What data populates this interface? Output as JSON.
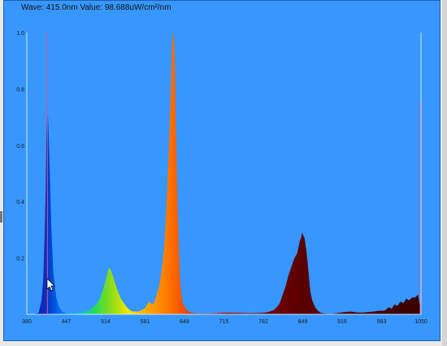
{
  "readout": {
    "label": "Wave: 415.0nm Value: 98.688uW/cm²/nm"
  },
  "colors": {
    "background": "#3797ff",
    "axis": "#c8e6ff",
    "cursor": "#cc5a8a"
  },
  "chart_data": {
    "type": "area",
    "title": "",
    "xlabel": "",
    "ylabel": "",
    "xlim": [
      380,
      1050
    ],
    "ylim": [
      0,
      1.0
    ],
    "grid": false,
    "x_ticks": [
      "380",
      "447",
      "514",
      "581",
      "648",
      "715",
      "782",
      "849",
      "916",
      "983",
      "1050"
    ],
    "y_ticks": [
      "1.0",
      "0.8",
      "0.6",
      "0.4",
      "0.2"
    ],
    "cursor_wavelength": 415.0,
    "series": [
      {
        "x": [
          380,
          390,
          400,
          405,
          408,
          410,
          412,
          413,
          414,
          415,
          416,
          417,
          418,
          420,
          422,
          425,
          430,
          435,
          440,
          445,
          450,
          455,
          460,
          470,
          480,
          490,
          500,
          505,
          510,
          515,
          518,
          520,
          522,
          525,
          530,
          535,
          540,
          545,
          550,
          555,
          560,
          570,
          580,
          585,
          588,
          590,
          593,
          596,
          600,
          605,
          610,
          613,
          616,
          619,
          622,
          625,
          626,
          627,
          628,
          629,
          630,
          631,
          632,
          633,
          634,
          636,
          638,
          640,
          642,
          645,
          650,
          655,
          660,
          670,
          680,
          690,
          700,
          710,
          720,
          740,
          760,
          780,
          790,
          800,
          805,
          810,
          815,
          820,
          825,
          830,
          835,
          838,
          840,
          842,
          844,
          846,
          848,
          850,
          852,
          855,
          858,
          860,
          862,
          865,
          870,
          875,
          880,
          890,
          900,
          910,
          920,
          930,
          940,
          950,
          960,
          970,
          980,
          985,
          990,
          995,
          1000,
          1005,
          1010,
          1015,
          1020,
          1025,
          1030,
          1035,
          1040,
          1045,
          1050
        ],
        "y": [
          0,
          0,
          0.005,
          0.05,
          0.13,
          0.26,
          0.44,
          0.58,
          0.68,
          0.72,
          0.7,
          0.64,
          0.58,
          0.43,
          0.29,
          0.15,
          0.06,
          0.025,
          0.01,
          0.005,
          0.003,
          0.003,
          0.004,
          0.006,
          0.01,
          0.02,
          0.04,
          0.06,
          0.09,
          0.13,
          0.155,
          0.165,
          0.16,
          0.145,
          0.11,
          0.08,
          0.055,
          0.04,
          0.025,
          0.015,
          0.01,
          0.01,
          0.02,
          0.035,
          0.045,
          0.04,
          0.035,
          0.04,
          0.065,
          0.1,
          0.17,
          0.23,
          0.33,
          0.46,
          0.62,
          0.82,
          0.9,
          0.95,
          0.99,
          1.0,
          0.98,
          0.93,
          0.84,
          0.72,
          0.6,
          0.4,
          0.25,
          0.14,
          0.08,
          0.04,
          0.02,
          0.01,
          0.005,
          0.003,
          0.003,
          0.003,
          0.004,
          0.005,
          0.006,
          0.005,
          0.004,
          0.005,
          0.008,
          0.015,
          0.025,
          0.04,
          0.07,
          0.1,
          0.14,
          0.17,
          0.2,
          0.21,
          0.22,
          0.24,
          0.26,
          0.27,
          0.29,
          0.28,
          0.27,
          0.23,
          0.17,
          0.12,
          0.08,
          0.05,
          0.025,
          0.012,
          0.005,
          0.002,
          0.002,
          0.005,
          0.008,
          0.01,
          0.007,
          0.006,
          0.008,
          0.01,
          0.013,
          0.012,
          0.015,
          0.025,
          0.02,
          0.035,
          0.03,
          0.045,
          0.04,
          0.055,
          0.05,
          0.06,
          0.06,
          0.07,
          0.005
        ]
      }
    ]
  }
}
